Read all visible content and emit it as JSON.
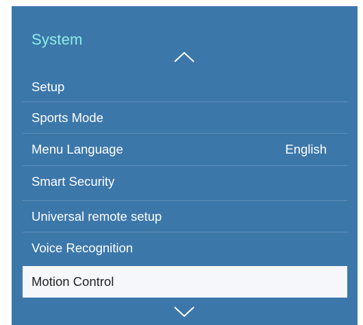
{
  "menu": {
    "title": "System",
    "items": [
      {
        "label": "Setup",
        "value": ""
      },
      {
        "label": "Sports Mode",
        "value": ""
      },
      {
        "label": "Menu Language",
        "value": "English"
      },
      {
        "label": "Smart Security",
        "value": ""
      },
      {
        "label": "Universal remote setup",
        "value": ""
      },
      {
        "label": "Voice Recognition",
        "value": ""
      },
      {
        "label": "Motion Control",
        "value": ""
      }
    ],
    "selected_index": 6
  },
  "icons": {
    "scroll_up": "chevron-up-icon",
    "scroll_down": "chevron-down-icon"
  },
  "colors": {
    "panel_background": "#3c77aa",
    "title_color": "#8ef0e4",
    "item_text": "#ffffff",
    "selected_background": "#f5f7fa",
    "selected_text": "#222222"
  }
}
